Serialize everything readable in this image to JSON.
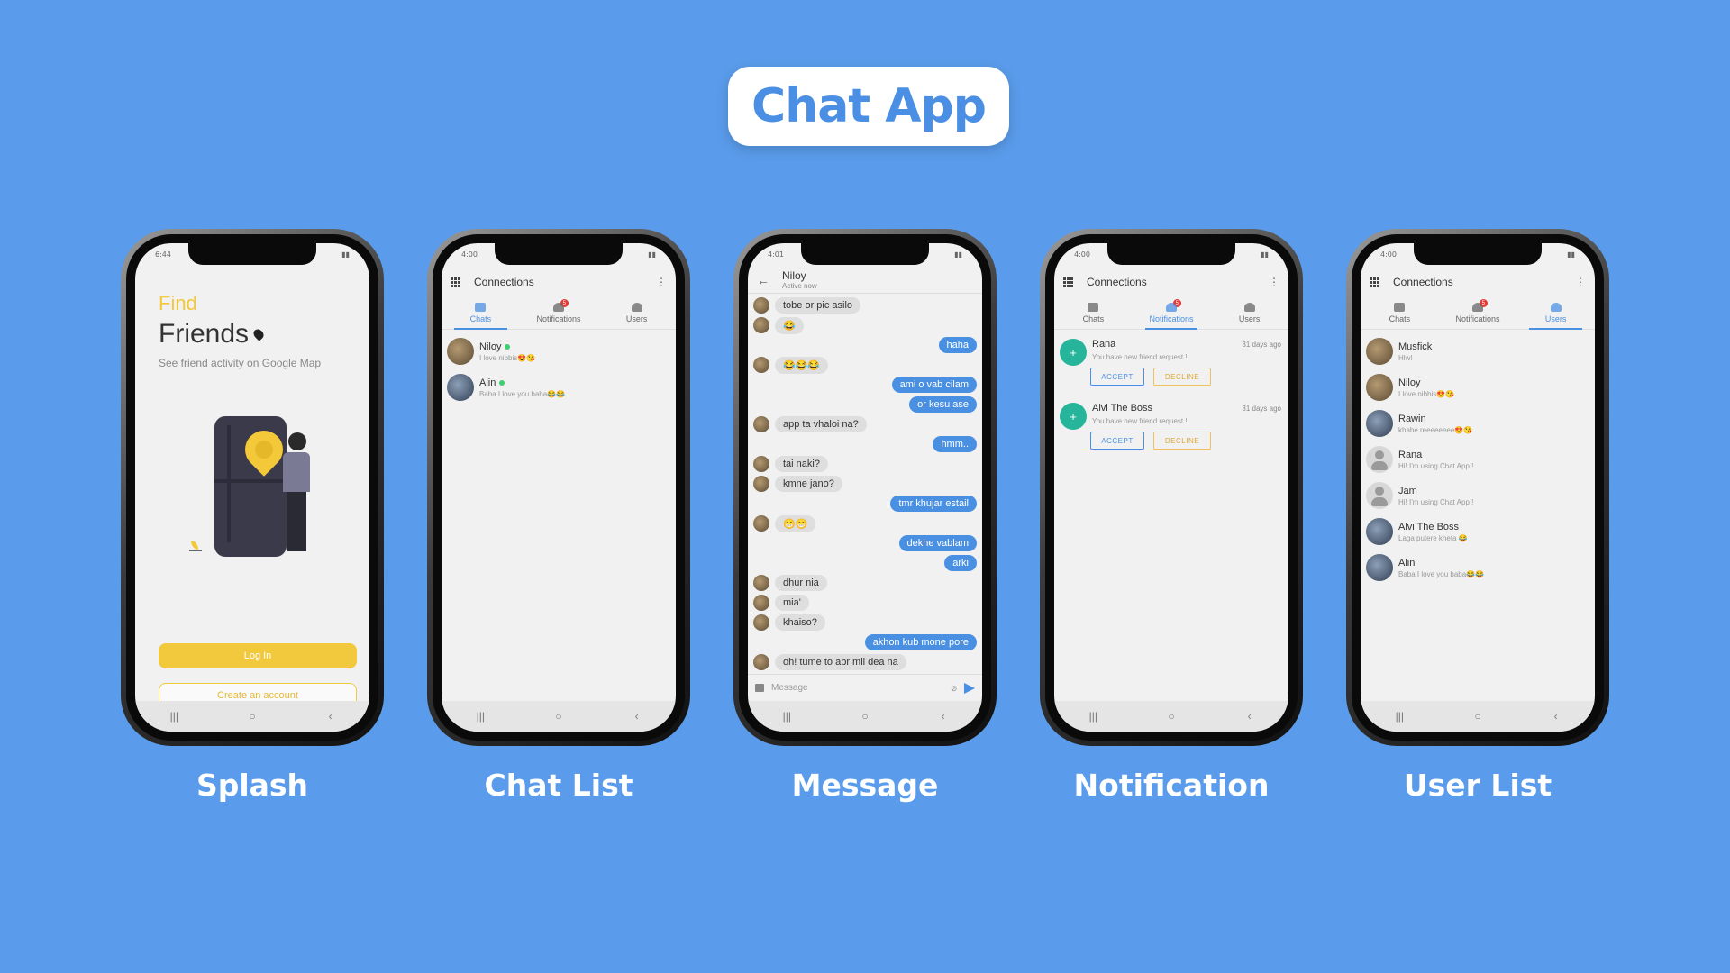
{
  "header": {
    "title": "Chat App"
  },
  "captions": [
    "Splash",
    "Chat List",
    "Message",
    "Notification",
    "User List"
  ],
  "splash": {
    "time": "6:44",
    "find": "Find",
    "friends": "Friends",
    "subtitle": "See friend activity on Google Map",
    "login_label": "Log In",
    "create_label": "Create an account"
  },
  "connections": {
    "title": "Connections",
    "tabs": [
      "Chats",
      "Notifications",
      "Users"
    ],
    "badge": "5",
    "time": "4:00"
  },
  "chat_list": {
    "time": "4:00",
    "items": [
      {
        "name": "Niloy",
        "message": "I love nibbis😍😘"
      },
      {
        "name": "Alin",
        "message": "Baba I love you baba😂😂"
      }
    ]
  },
  "message": {
    "time": "4:01",
    "contact": "Niloy",
    "status": "Active now",
    "placeholder": "Message",
    "thread": [
      {
        "dir": "in",
        "text": "tobe or pic asilo"
      },
      {
        "dir": "in",
        "text": "😂"
      },
      {
        "dir": "out",
        "text": "haha"
      },
      {
        "dir": "in",
        "text": "😂😂😂"
      },
      {
        "dir": "out",
        "text": "ami o vab cilam"
      },
      {
        "dir": "out",
        "text": "or kesu ase"
      },
      {
        "dir": "in",
        "text": "app ta vhaloi na?"
      },
      {
        "dir": "out",
        "text": "hmm.."
      },
      {
        "dir": "in",
        "text": "tai naki?"
      },
      {
        "dir": "in",
        "text": "kmne jano?"
      },
      {
        "dir": "out",
        "text": "tmr khujar estail"
      },
      {
        "dir": "in",
        "text": "😁😁"
      },
      {
        "dir": "out",
        "text": "dekhe vablam"
      },
      {
        "dir": "out",
        "text": "arki"
      },
      {
        "dir": "in",
        "text": "dhur nia"
      },
      {
        "dir": "in",
        "text": "mia'"
      },
      {
        "dir": "in",
        "text": "khaiso?"
      },
      {
        "dir": "out",
        "text": "akhon kub mone pore"
      },
      {
        "dir": "in",
        "text": "oh! tume to abr mil dea na"
      }
    ]
  },
  "notifications": {
    "items": [
      {
        "name": "Rana",
        "time": "31 days ago",
        "message": "You have new friend request !",
        "accept": "ACCEPT",
        "decline": "DECLINE"
      },
      {
        "name": "Alvi The Boss",
        "time": "31 days ago",
        "message": "You have new friend request !",
        "accept": "ACCEPT",
        "decline": "DECLINE"
      }
    ]
  },
  "user_list": {
    "items": [
      {
        "name": "Musfick",
        "message": "Hlw!"
      },
      {
        "name": "Niloy",
        "message": "I love nibbis😍😘"
      },
      {
        "name": "Rawin",
        "message": "khabe reeeeeeee😍😘"
      },
      {
        "name": "Rana",
        "message": "Hi! I'm using Chat App !"
      },
      {
        "name": "Jam",
        "message": "Hi! I'm using Chat App !"
      },
      {
        "name": "Alvi The Boss",
        "message": "Laga putere kheta 😂"
      },
      {
        "name": "Alin",
        "message": "Baba I love you baba😂😂"
      }
    ]
  },
  "colors": {
    "background": "#5a9ceb",
    "accent": "#4a90e2",
    "yellow": "#f2c93d",
    "online": "#3ccf6b",
    "badge": "#e53935",
    "teal": "#26b59a"
  }
}
